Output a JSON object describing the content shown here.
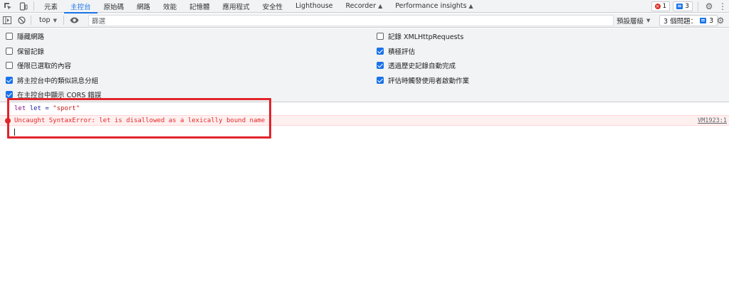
{
  "tabs": [
    {
      "label": "元素",
      "active": false,
      "experimental": false
    },
    {
      "label": "主控台",
      "active": true,
      "experimental": false
    },
    {
      "label": "原始碼",
      "active": false,
      "experimental": false
    },
    {
      "label": "網路",
      "active": false,
      "experimental": false
    },
    {
      "label": "效能",
      "active": false,
      "experimental": false
    },
    {
      "label": "記憶體",
      "active": false,
      "experimental": false
    },
    {
      "label": "應用程式",
      "active": false,
      "experimental": false
    },
    {
      "label": "安全性",
      "active": false,
      "experimental": false
    },
    {
      "label": "Lighthouse",
      "active": false,
      "experimental": false
    },
    {
      "label": "Recorder",
      "active": false,
      "experimental": true
    },
    {
      "label": "Performance insights",
      "active": false,
      "experimental": true
    }
  ],
  "status": {
    "error_count": "1",
    "message_count": "3"
  },
  "toolbar": {
    "context": "top",
    "filter_placeholder": "篩選",
    "levels_label": "預設層級",
    "issues_label": "3 個問題：",
    "issues_count": "3"
  },
  "settings": {
    "left": [
      {
        "label": "隱藏網路",
        "checked": false
      },
      {
        "label": "保留記錄",
        "checked": false
      },
      {
        "label": "僅限已選取的內容",
        "checked": false
      },
      {
        "label": "將主控台中的類似訊息分組",
        "checked": true
      },
      {
        "label": "在主控台中顯示 CORS 錯誤",
        "checked": true
      }
    ],
    "right": [
      {
        "label": "記錄 XMLHttpRequests",
        "checked": false
      },
      {
        "label": "積極評估",
        "checked": true
      },
      {
        "label": "透過歷史記錄自動完成",
        "checked": true
      },
      {
        "label": "評估時觸發使用者啟動作業",
        "checked": true
      }
    ]
  },
  "console": {
    "input_kw1": "let",
    "input_kw2": "let",
    "input_op": " = ",
    "input_str": "\"sport\"",
    "error_text": "Uncaught SyntaxError: let is disallowed as a lexically bound name",
    "error_source": "VM1923:1"
  },
  "colors": {
    "accent": "#1a73e8",
    "error": "#e22929",
    "annotation": "#e0242a"
  }
}
